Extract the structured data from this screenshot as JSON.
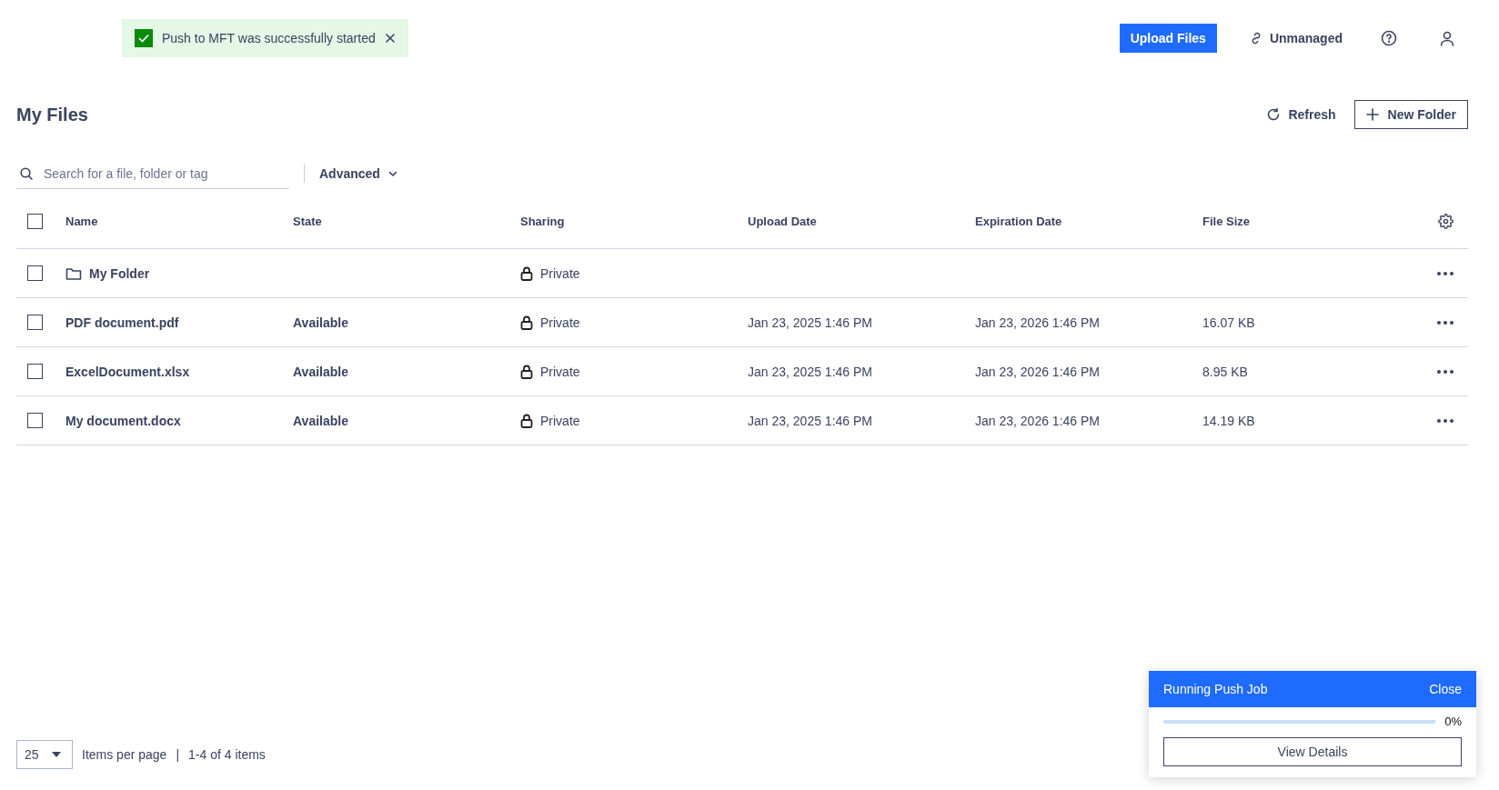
{
  "toast": {
    "message": "Push to MFT was successfully started"
  },
  "top_bar": {
    "upload_button": "Upload Files",
    "unmanaged": "Unmanaged"
  },
  "page": {
    "title": "My Files",
    "refresh": "Refresh",
    "new_folder": "New Folder"
  },
  "search": {
    "placeholder": "Search for a file, folder or tag",
    "advanced": "Advanced"
  },
  "table": {
    "select_all_checked": false,
    "columns": [
      "Name",
      "State",
      "Sharing",
      "Upload Date",
      "Expiration Date",
      "File Size"
    ],
    "rows": [
      {
        "kind": "folder",
        "checked": false,
        "name": "My Folder",
        "state": "",
        "sharing": "Private",
        "upload_date": "",
        "expiration_date": "",
        "file_size": ""
      },
      {
        "kind": "file",
        "checked": false,
        "name": "PDF document.pdf",
        "state": "Available",
        "sharing": "Private",
        "upload_date": "Jan 23, 2025 1:46 PM",
        "expiration_date": "Jan 23, 2026 1:46 PM",
        "file_size": "16.07 KB"
      },
      {
        "kind": "file",
        "checked": false,
        "name": "ExcelDocument.xlsx",
        "state": "Available",
        "sharing": "Private",
        "upload_date": "Jan 23, 2025 1:46 PM",
        "expiration_date": "Jan 23, 2026 1:46 PM",
        "file_size": "8.95 KB"
      },
      {
        "kind": "file",
        "checked": false,
        "name": "My document.docx",
        "state": "Available",
        "sharing": "Private",
        "upload_date": "Jan 23, 2025 1:46 PM",
        "expiration_date": "Jan 23, 2026 1:46 PM",
        "file_size": "14.19 KB"
      }
    ]
  },
  "pagination": {
    "page_size": "25",
    "label": "Items per page",
    "separator": "|",
    "range": "1-4 of 4 items"
  },
  "job_panel": {
    "title": "Running Push Job",
    "close": "Close",
    "percent": "0%",
    "details_button": "View Details"
  }
}
